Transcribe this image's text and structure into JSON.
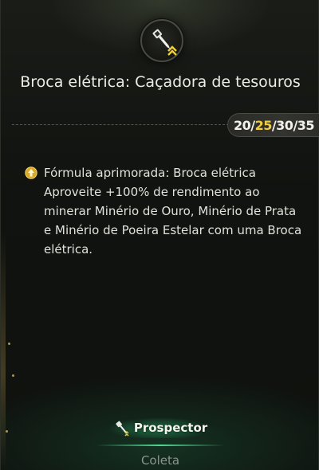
{
  "skill": {
    "title": "Broca elétrica: Caçadora de tesouros",
    "icon": "drill-icon",
    "rank_icon": "double-chevron-up-icon",
    "levels": [
      "20",
      "25",
      "30",
      "35"
    ],
    "levels_separator": "/"
  },
  "effect": {
    "icon": "upgrade-arrow-icon",
    "heading": "Fórmula aprimorada: Broca elétrica",
    "description": "Aproveite +100% de rendimento ao minerar Minério de Ouro, Minério de Prata e Minério de Poeira Estelar com uma Broca elétrica."
  },
  "footer": {
    "profession_icon": "drill-icon",
    "profession": "Prospector",
    "category": "Coleta"
  },
  "colors": {
    "accent_yellow": "#f1cf3a",
    "glow_green": "#5ae6a0",
    "background": "#121411"
  }
}
